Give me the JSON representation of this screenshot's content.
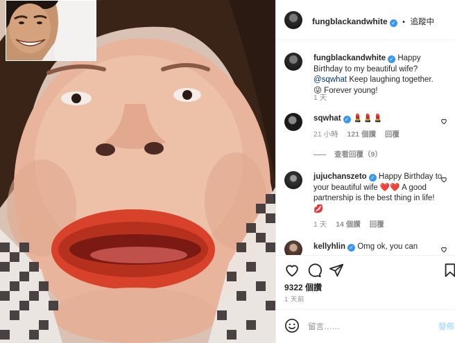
{
  "post": {
    "author": "fungblackandwhite",
    "follow_status": "追蹤中",
    "separator": "•",
    "caption_username": "fungblackandwhite",
    "caption_pre": "Happy Birthday to my beautiful wife?",
    "caption_mention": "@sqwhat",
    "caption_post": "Keep laughing together. 😜 Forever young!",
    "caption_time": "1 天"
  },
  "comments": [
    {
      "username": "sqwhat",
      "text": "💄💄💄",
      "time": "21 小時",
      "likes": "121 個讚",
      "reply": "回覆",
      "view_replies": "查看回覆（9）"
    },
    {
      "username": "jujuchanszeto",
      "text": "Happy Birthday to your beautiful wife ❤️❤️ A good partnership is the best thing in life! 💋",
      "time": "1 天",
      "likes": "14 個讚",
      "reply": "回覆"
    },
    {
      "username": "kellyhlin",
      "text": "Omg ok, you can"
    }
  ],
  "footer": {
    "likes": "9322 個讚",
    "time": "1 天前",
    "comment_placeholder": "留言……",
    "post_label": "發佈"
  },
  "icons": {
    "heart": "heart-icon",
    "comment": "comment-icon",
    "share": "paper-plane-icon",
    "save": "bookmark-icon",
    "emoji": "smiley-icon",
    "verified": "verified-badge-icon"
  },
  "colors": {
    "verified": "#3897f0",
    "link": "#00376b",
    "muted": "#8e8e8e",
    "post_button": "#b2dffc"
  }
}
